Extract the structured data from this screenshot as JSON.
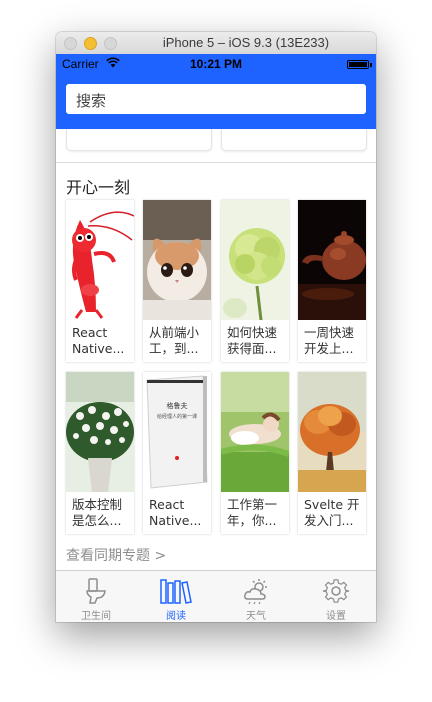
{
  "window": {
    "title": "iPhone 5 – iOS 9.3 (13E233)"
  },
  "statusbar": {
    "carrier": "Carrier",
    "time": "10:21 PM"
  },
  "search": {
    "placeholder": "搜索"
  },
  "section": {
    "title": "开心一刻",
    "more_link": "查看同期专题 >"
  },
  "cards": [
    {
      "label": "React Native...",
      "image": "red-lobster-cartoon"
    },
    {
      "label": "从前端小工，到...",
      "image": "kitten-photo"
    },
    {
      "label": "如何快速获得面...",
      "image": "green-carnation-photo"
    },
    {
      "label": "一周快速开发上...",
      "image": "teapot-photo"
    },
    {
      "label": "版本控制是怎么...",
      "image": "white-flowers-photo"
    },
    {
      "label": "React Native...",
      "image": "book-cover"
    },
    {
      "label": "工作第一年，你...",
      "image": "woman-grass-photo"
    },
    {
      "label": "Svelte 开发入门...",
      "image": "autumn-tree-photo"
    }
  ],
  "book_cover_text": {
    "title": "格鲁夫",
    "subtitle": "给经理人的第一课"
  },
  "tabs": [
    {
      "label": "卫生间",
      "icon": "toilet-icon",
      "active": false
    },
    {
      "label": "阅读",
      "icon": "books-icon",
      "active": true
    },
    {
      "label": "天气",
      "icon": "weather-icon",
      "active": false
    },
    {
      "label": "设置",
      "icon": "gear-icon",
      "active": false
    }
  ],
  "colors": {
    "accent": "#1e63ff",
    "inactive": "#8e8e8e"
  }
}
